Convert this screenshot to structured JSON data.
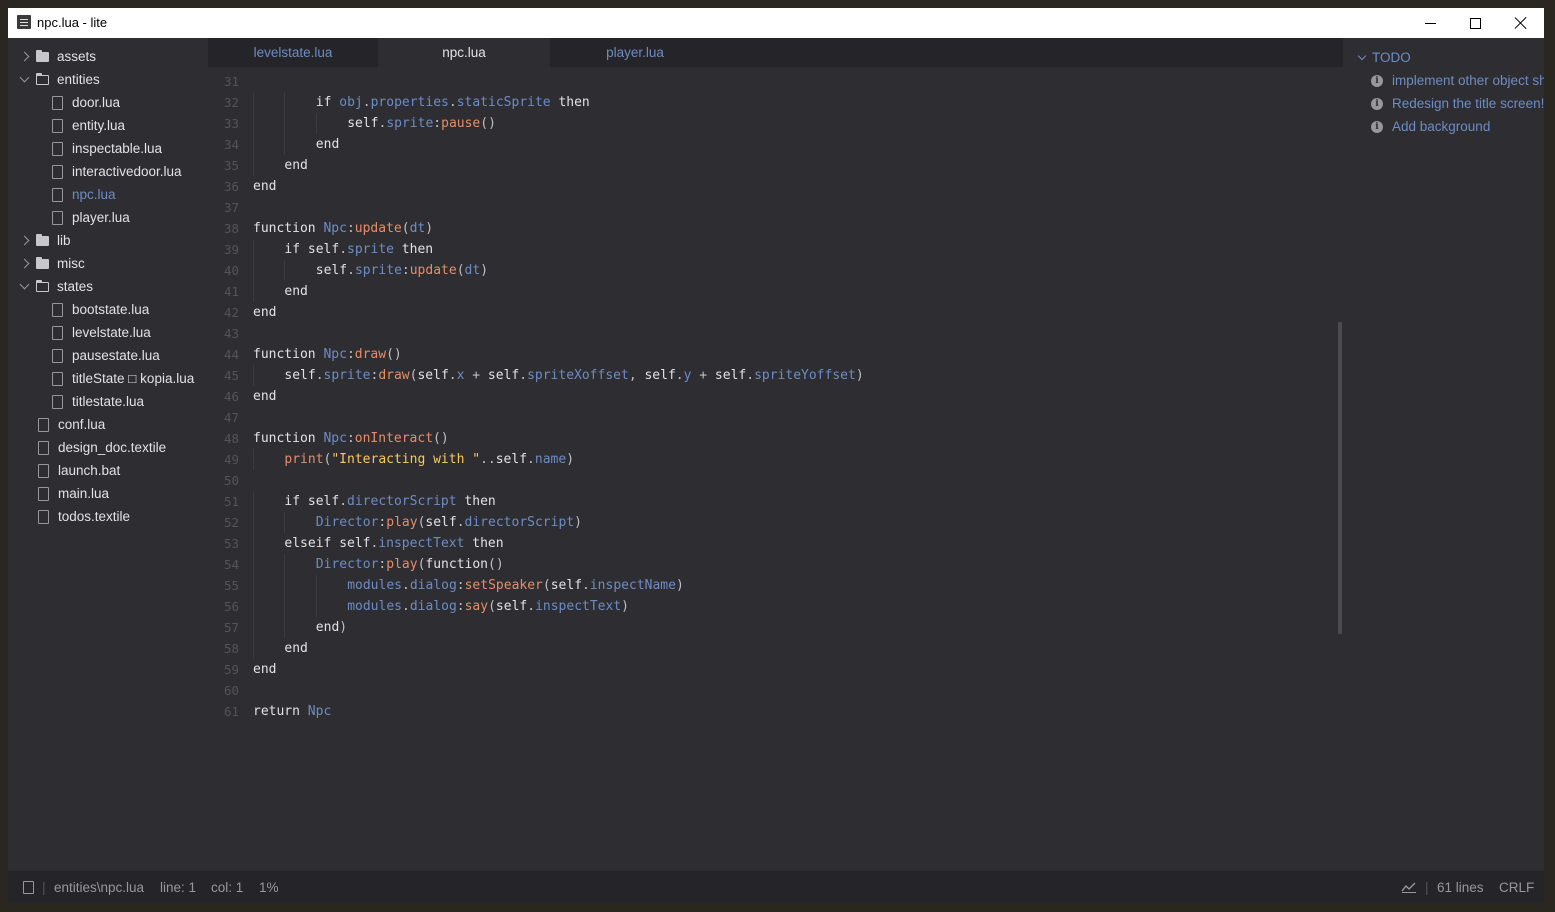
{
  "window": {
    "title": "npc.lua - lite"
  },
  "sidebar": {
    "items": [
      {
        "label": "assets",
        "kind": "folder",
        "depth": 0,
        "expanded": false
      },
      {
        "label": "entities",
        "kind": "folder",
        "depth": 0,
        "expanded": true
      },
      {
        "label": "door.lua",
        "kind": "file",
        "depth": 1
      },
      {
        "label": "entity.lua",
        "kind": "file",
        "depth": 1
      },
      {
        "label": "inspectable.lua",
        "kind": "file",
        "depth": 1
      },
      {
        "label": "interactivedoor.lua",
        "kind": "file",
        "depth": 1
      },
      {
        "label": "npc.lua",
        "kind": "file",
        "depth": 1,
        "active": true
      },
      {
        "label": "player.lua",
        "kind": "file",
        "depth": 1
      },
      {
        "label": "lib",
        "kind": "folder",
        "depth": 0,
        "expanded": false
      },
      {
        "label": "misc",
        "kind": "folder",
        "depth": 0,
        "expanded": false
      },
      {
        "label": "states",
        "kind": "folder",
        "depth": 0,
        "expanded": true
      },
      {
        "label": "bootstate.lua",
        "kind": "file",
        "depth": 1
      },
      {
        "label": "levelstate.lua",
        "kind": "file",
        "depth": 1
      },
      {
        "label": "pausestate.lua",
        "kind": "file",
        "depth": 1
      },
      {
        "label": "titleState □ kopia.lua",
        "kind": "file",
        "depth": 1
      },
      {
        "label": "titlestate.lua",
        "kind": "file",
        "depth": 1
      },
      {
        "label": "conf.lua",
        "kind": "file",
        "depth": 0
      },
      {
        "label": "design_doc.textile",
        "kind": "file",
        "depth": 0
      },
      {
        "label": "launch.bat",
        "kind": "file",
        "depth": 0
      },
      {
        "label": "main.lua",
        "kind": "file",
        "depth": 0
      },
      {
        "label": "todos.textile",
        "kind": "file",
        "depth": 0
      }
    ]
  },
  "tabs": [
    {
      "label": "levelstate.lua",
      "active": false
    },
    {
      "label": "npc.lua",
      "active": true
    },
    {
      "label": "player.lua",
      "active": false
    }
  ],
  "editor": {
    "lines": [
      {
        "n": "31",
        "indent": 0,
        "tokens": []
      },
      {
        "n": "32",
        "indent": 2,
        "tokens": [
          [
            "k",
            "if "
          ],
          [
            "p",
            "obj"
          ],
          [
            "t",
            "."
          ],
          [
            "p",
            "properties"
          ],
          [
            "t",
            "."
          ],
          [
            "p",
            "staticSprite"
          ],
          [
            "k",
            " then"
          ]
        ]
      },
      {
        "n": "33",
        "indent": 3,
        "tokens": [
          [
            "k",
            "self"
          ],
          [
            "t",
            "."
          ],
          [
            "p",
            "sprite"
          ],
          [
            "t",
            ":"
          ],
          [
            "f",
            "pause"
          ],
          [
            "t",
            "()"
          ]
        ]
      },
      {
        "n": "34",
        "indent": 2,
        "tokens": [
          [
            "k",
            "end"
          ]
        ]
      },
      {
        "n": "35",
        "indent": 1,
        "tokens": [
          [
            "k",
            "end"
          ]
        ]
      },
      {
        "n": "36",
        "indent": 0,
        "tokens": [
          [
            "k",
            "end"
          ]
        ]
      },
      {
        "n": "37",
        "indent": 0,
        "tokens": []
      },
      {
        "n": "38",
        "indent": 0,
        "tokens": [
          [
            "k",
            "function "
          ],
          [
            "p",
            "Npc"
          ],
          [
            "t",
            ":"
          ],
          [
            "f",
            "update"
          ],
          [
            "t",
            "("
          ],
          [
            "p",
            "dt"
          ],
          [
            "t",
            ")"
          ]
        ]
      },
      {
        "n": "39",
        "indent": 1,
        "tokens": [
          [
            "k",
            "if "
          ],
          [
            "k",
            "self"
          ],
          [
            "t",
            "."
          ],
          [
            "p",
            "sprite"
          ],
          [
            "k",
            " then"
          ]
        ]
      },
      {
        "n": "40",
        "indent": 2,
        "tokens": [
          [
            "k",
            "self"
          ],
          [
            "t",
            "."
          ],
          [
            "p",
            "sprite"
          ],
          [
            "t",
            ":"
          ],
          [
            "f",
            "update"
          ],
          [
            "t",
            "("
          ],
          [
            "p",
            "dt"
          ],
          [
            "t",
            ")"
          ]
        ]
      },
      {
        "n": "41",
        "indent": 1,
        "tokens": [
          [
            "k",
            "end"
          ]
        ]
      },
      {
        "n": "42",
        "indent": 0,
        "tokens": [
          [
            "k",
            "end"
          ]
        ]
      },
      {
        "n": "43",
        "indent": 0,
        "tokens": []
      },
      {
        "n": "44",
        "indent": 0,
        "tokens": [
          [
            "k",
            "function "
          ],
          [
            "p",
            "Npc"
          ],
          [
            "t",
            ":"
          ],
          [
            "f",
            "draw"
          ],
          [
            "t",
            "()"
          ]
        ]
      },
      {
        "n": "45",
        "indent": 1,
        "tokens": [
          [
            "k",
            "self"
          ],
          [
            "t",
            "."
          ],
          [
            "p",
            "sprite"
          ],
          [
            "t",
            ":"
          ],
          [
            "f",
            "draw"
          ],
          [
            "t",
            "("
          ],
          [
            "k",
            "self"
          ],
          [
            "t",
            "."
          ],
          [
            "p",
            "x"
          ],
          [
            "t",
            " + "
          ],
          [
            "k",
            "self"
          ],
          [
            "t",
            "."
          ],
          [
            "p",
            "spriteXoffset"
          ],
          [
            "t",
            ", "
          ],
          [
            "k",
            "self"
          ],
          [
            "t",
            "."
          ],
          [
            "p",
            "y"
          ],
          [
            "t",
            " + "
          ],
          [
            "k",
            "self"
          ],
          [
            "t",
            "."
          ],
          [
            "p",
            "spriteYoffset"
          ],
          [
            "t",
            ")"
          ]
        ]
      },
      {
        "n": "46",
        "indent": 0,
        "tokens": [
          [
            "k",
            "end"
          ]
        ]
      },
      {
        "n": "47",
        "indent": 0,
        "tokens": []
      },
      {
        "n": "48",
        "indent": 0,
        "tokens": [
          [
            "k",
            "function "
          ],
          [
            "p",
            "Npc"
          ],
          [
            "t",
            ":"
          ],
          [
            "f",
            "onInteract"
          ],
          [
            "t",
            "()"
          ]
        ]
      },
      {
        "n": "49",
        "indent": 1,
        "tokens": [
          [
            "f",
            "print"
          ],
          [
            "t",
            "("
          ],
          [
            "s",
            "\"Interacting with \""
          ],
          [
            "t",
            ".."
          ],
          [
            "k",
            "self"
          ],
          [
            "t",
            "."
          ],
          [
            "p",
            "name"
          ],
          [
            "t",
            ")"
          ]
        ]
      },
      {
        "n": "50",
        "indent": 0,
        "tokens": []
      },
      {
        "n": "51",
        "indent": 1,
        "tokens": [
          [
            "k",
            "if "
          ],
          [
            "k",
            "self"
          ],
          [
            "t",
            "."
          ],
          [
            "p",
            "directorScript"
          ],
          [
            "k",
            " then"
          ]
        ]
      },
      {
        "n": "52",
        "indent": 2,
        "tokens": [
          [
            "p",
            "Director"
          ],
          [
            "t",
            ":"
          ],
          [
            "f",
            "play"
          ],
          [
            "t",
            "("
          ],
          [
            "k",
            "self"
          ],
          [
            "t",
            "."
          ],
          [
            "p",
            "directorScript"
          ],
          [
            "t",
            ")"
          ]
        ]
      },
      {
        "n": "53",
        "indent": 1,
        "tokens": [
          [
            "k",
            "elseif "
          ],
          [
            "k",
            "self"
          ],
          [
            "t",
            "."
          ],
          [
            "p",
            "inspectText"
          ],
          [
            "k",
            " then"
          ]
        ]
      },
      {
        "n": "54",
        "indent": 2,
        "tokens": [
          [
            "p",
            "Director"
          ],
          [
            "t",
            ":"
          ],
          [
            "f",
            "play"
          ],
          [
            "t",
            "("
          ],
          [
            "k",
            "function"
          ],
          [
            "t",
            "()"
          ]
        ]
      },
      {
        "n": "55",
        "indent": 3,
        "tokens": [
          [
            "p",
            "modules"
          ],
          [
            "t",
            "."
          ],
          [
            "p",
            "dialog"
          ],
          [
            "t",
            ":"
          ],
          [
            "f",
            "setSpeaker"
          ],
          [
            "t",
            "("
          ],
          [
            "k",
            "self"
          ],
          [
            "t",
            "."
          ],
          [
            "p",
            "inspectName"
          ],
          [
            "t",
            ")"
          ]
        ]
      },
      {
        "n": "56",
        "indent": 3,
        "tokens": [
          [
            "p",
            "modules"
          ],
          [
            "t",
            "."
          ],
          [
            "p",
            "dialog"
          ],
          [
            "t",
            ":"
          ],
          [
            "f",
            "say"
          ],
          [
            "t",
            "("
          ],
          [
            "k",
            "self"
          ],
          [
            "t",
            "."
          ],
          [
            "p",
            "inspectText"
          ],
          [
            "t",
            ")"
          ]
        ]
      },
      {
        "n": "57",
        "indent": 2,
        "tokens": [
          [
            "k",
            "end"
          ],
          [
            "t",
            ")"
          ]
        ]
      },
      {
        "n": "58",
        "indent": 1,
        "tokens": [
          [
            "k",
            "end"
          ]
        ]
      },
      {
        "n": "59",
        "indent": 0,
        "tokens": [
          [
            "k",
            "end"
          ]
        ]
      },
      {
        "n": "60",
        "indent": 0,
        "tokens": []
      },
      {
        "n": "61",
        "indent": 0,
        "tokens": [
          [
            "k",
            "return "
          ],
          [
            "p",
            "Npc"
          ]
        ]
      }
    ]
  },
  "todo": {
    "header": "TODO",
    "items": [
      "implement other object sha",
      "Redesign the title screen!!!",
      "Add background"
    ]
  },
  "status": {
    "path": "entities\\npc.lua",
    "separator": "|",
    "line": "line: 1",
    "col": "col: 1",
    "percent": "1%",
    "line_count": "61 lines",
    "line_ending": "CRLF"
  },
  "colors": {
    "background": "#2e2e32",
    "panel_dark": "#252529",
    "accent": "#6d8cc4",
    "function": "#e58d6a",
    "string": "#f7c95c",
    "text": "#e1e1e6",
    "line_number": "#53535a"
  }
}
